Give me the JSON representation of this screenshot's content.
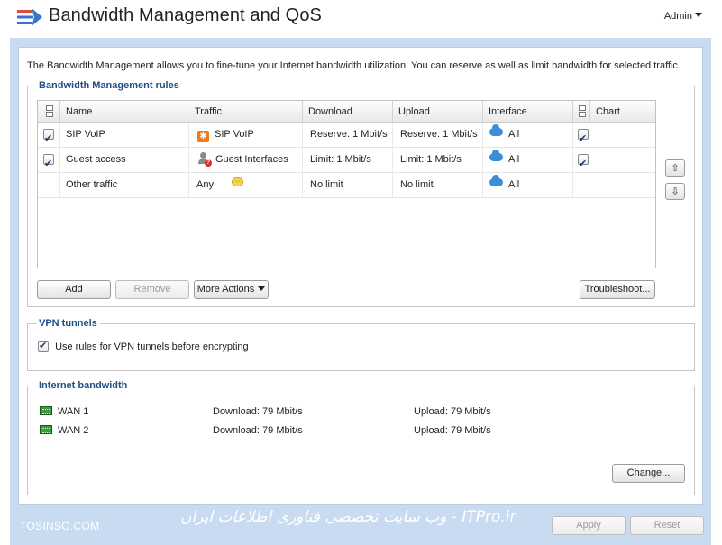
{
  "header": {
    "title": "Bandwidth Management and QoS",
    "app_icon": "bandwidth-arrows-icon",
    "user_menu_label": "Admin"
  },
  "intro_text": "The Bandwidth Management allows you to fine-tune your Internet bandwidth utilization. You can reserve as well as limit bandwidth for selected traffic.",
  "rules": {
    "group_title": "Bandwidth Management rules",
    "columns": [
      "Name",
      "Traffic",
      "Download",
      "Upload",
      "Interface",
      "Chart"
    ],
    "rows": [
      {
        "enabled": true,
        "name": "SIP VoIP",
        "traffic": "SIP VoIP",
        "traffic_icon": "sip-icon",
        "download": "Reserve: 1 Mbit/s",
        "upload": "Reserve: 1 Mbit/s",
        "interface": "All",
        "chart": true
      },
      {
        "enabled": true,
        "name": "Guest access",
        "traffic": "Guest Interfaces",
        "traffic_icon": "guest-user-icon",
        "download": "Limit: 1 Mbit/s",
        "upload": "Limit: 1 Mbit/s",
        "interface": "All",
        "chart": true
      },
      {
        "enabled": null,
        "name": "Other traffic",
        "traffic": "Any",
        "traffic_icon": "",
        "download": "No limit",
        "upload": "No limit",
        "interface": "All",
        "chart": null,
        "has_comment": true
      }
    ],
    "buttons": {
      "add": "Add",
      "remove": "Remove",
      "more_actions": "More Actions",
      "troubleshoot": "Troubleshoot..."
    }
  },
  "vpn": {
    "group_title": "VPN tunnels",
    "use_rules_label": "Use rules for VPN tunnels before encrypting",
    "use_rules_checked": true
  },
  "internet_bandwidth": {
    "group_title": "Internet bandwidth",
    "links": [
      {
        "name": "WAN 1",
        "download": "Download: 79 Mbit/s",
        "upload": "Upload: 79 Mbit/s"
      },
      {
        "name": "WAN 2",
        "download": "Download: 79 Mbit/s",
        "upload": "Upload: 79 Mbit/s"
      }
    ],
    "change_label": "Change..."
  },
  "footer": {
    "apply": "Apply",
    "reset": "Reset",
    "watermark_left": "TOSINSO.COM",
    "watermark_right": "وب سایت تخصصی فناوری اطلاعات ایران - ITPro.ir"
  }
}
